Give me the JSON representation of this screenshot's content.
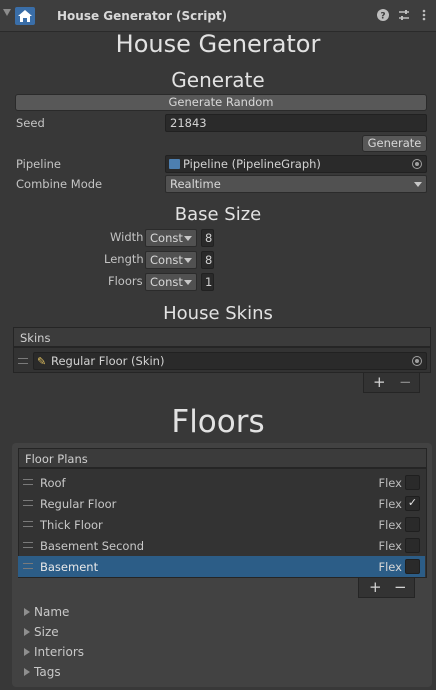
{
  "header": {
    "title": "House Generator (Script)",
    "icons": [
      "help-icon",
      "sliders-icon",
      "more-icon"
    ]
  },
  "main_title": "House Generator",
  "generate": {
    "heading": "Generate",
    "random_button": "Generate Random",
    "seed_label": "Seed",
    "seed_value": "21843",
    "generate_button": "Generate",
    "pipeline_label": "Pipeline",
    "pipeline_value": "Pipeline (PipelineGraph)",
    "combine_label": "Combine Mode",
    "combine_value": "Realtime"
  },
  "base_size": {
    "heading": "Base Size",
    "rows": [
      {
        "label": "Width",
        "mode": "Const",
        "value": "8"
      },
      {
        "label": "Length",
        "mode": "Const",
        "value": "8"
      },
      {
        "label": "Floors",
        "mode": "Const",
        "value": "1"
      }
    ]
  },
  "house_skins": {
    "heading": "House Skins",
    "list_header": "Skins",
    "items": [
      {
        "value": "Regular Floor (Skin)"
      }
    ],
    "add": "+",
    "remove": "−"
  },
  "floors": {
    "heading": "Floors",
    "list_header": "Floor Plans",
    "items": [
      {
        "label": "Roof",
        "flex": "Flex",
        "checked": ""
      },
      {
        "label": "Regular Floor",
        "flex": "Flex",
        "checked": "✓"
      },
      {
        "label": "Thick Floor",
        "flex": "Flex",
        "checked": ""
      },
      {
        "label": "Basement Second",
        "flex": "Flex",
        "checked": ""
      },
      {
        "label": "Basement",
        "flex": "Flex",
        "checked": ""
      }
    ],
    "selected_index": 4,
    "add": "+",
    "remove": "−",
    "foldouts": [
      "Name",
      "Size",
      "Interiors",
      "Tags"
    ]
  },
  "colors": {
    "selection": "#2c5d87",
    "accent": "#3a6ea8"
  }
}
